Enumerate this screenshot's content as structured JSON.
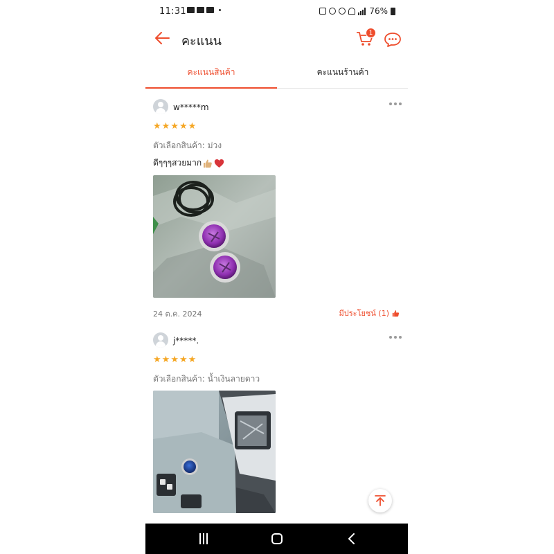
{
  "status_bar": {
    "time": "11:31",
    "battery_percent": "76%"
  },
  "header": {
    "title": "คะแนน",
    "cart_badge": "1"
  },
  "tabs": [
    {
      "label": "คะแนนสินค้า",
      "active": true
    },
    {
      "label": "คะแนนร้านค้า",
      "active": false
    }
  ],
  "reviews": [
    {
      "username": "w*****m",
      "rating": 5,
      "variant": "ตัวเลือกสินค้า: ม่วง",
      "comment": "ดีๆๆๆสวยมาก",
      "comment_emoji": [
        "thumbs-up",
        "heart"
      ],
      "date": "24 ต.ค. 2024",
      "helpful": "มีประโยชน์ (1)"
    },
    {
      "username": "j*****.",
      "rating": 5,
      "variant": "ตัวเลือกสินค้า: น้ำเงินลายดาว"
    }
  ],
  "colors": {
    "accent": "#ee4d2d",
    "star": "#f5a623",
    "muted_text": "#757575"
  },
  "icons": [
    "back-arrow-icon",
    "cart-icon",
    "chat-icon",
    "more-icon",
    "thumbs-up-icon",
    "scroll-top-icon"
  ]
}
